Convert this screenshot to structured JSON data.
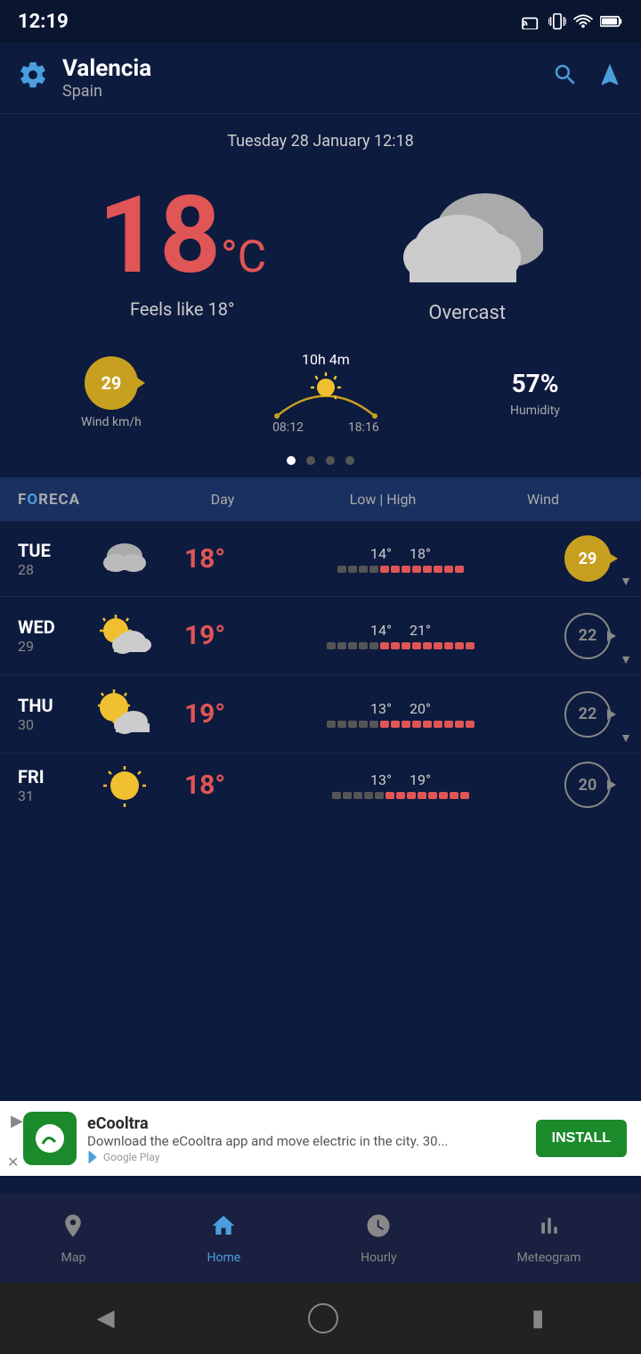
{
  "statusBar": {
    "time": "12:19",
    "icons": [
      "cast",
      "vibrate",
      "wifi",
      "battery"
    ]
  },
  "header": {
    "city": "Valencia",
    "country": "Spain",
    "gear_label": "⚙",
    "search_label": "🔍",
    "location_label": "➤"
  },
  "dateBar": {
    "text": "Tuesday 28 January 12:18"
  },
  "currentWeather": {
    "temperature": "18",
    "unit": "°C",
    "feelsLike": "Feels like 18°",
    "description": "Overcast"
  },
  "details": {
    "wind": {
      "value": "29",
      "label": "Wind km/h"
    },
    "sun": {
      "duration": "10h 4m",
      "rise": "08:12",
      "set": "18:16"
    },
    "humidity": {
      "value": "57%",
      "label": "Humidity"
    }
  },
  "forecast": {
    "header": {
      "logo": "FORECA",
      "col1": "Day",
      "col2": "Low | High",
      "col3": "Wind"
    },
    "rows": [
      {
        "dayName": "TUE",
        "dayNum": "28",
        "temp": "18°",
        "low": "14°",
        "high": "18°",
        "wind": "29",
        "windStyle": "gold",
        "coldSegs": 4,
        "warmSegs": 8
      },
      {
        "dayName": "WED",
        "dayNum": "29",
        "temp": "19°",
        "low": "14°",
        "high": "21°",
        "wind": "22",
        "windStyle": "gray",
        "coldSegs": 5,
        "warmSegs": 9
      },
      {
        "dayName": "THU",
        "dayNum": "30",
        "temp": "19°",
        "low": "13°",
        "high": "20°",
        "wind": "22",
        "windStyle": "gray",
        "coldSegs": 5,
        "warmSegs": 9
      },
      {
        "dayName": "FRI",
        "dayNum": "31",
        "temp": "18°",
        "low": "13°",
        "high": "19°",
        "wind": "20",
        "windStyle": "gray",
        "coldSegs": 5,
        "warmSegs": 8
      }
    ]
  },
  "ad": {
    "title": "eCooltra",
    "subtitle": "Download the eCooltra app and move electric in the city. 30...",
    "installLabel": "INSTALL",
    "source": "Google Play"
  },
  "bottomNav": {
    "items": [
      {
        "icon": "📍",
        "label": "Map",
        "active": false
      },
      {
        "icon": "🏠",
        "label": "Home",
        "active": true
      },
      {
        "icon": "🕐",
        "label": "Hourly",
        "active": false
      },
      {
        "icon": "📊",
        "label": "Meteogram",
        "active": false
      }
    ]
  }
}
